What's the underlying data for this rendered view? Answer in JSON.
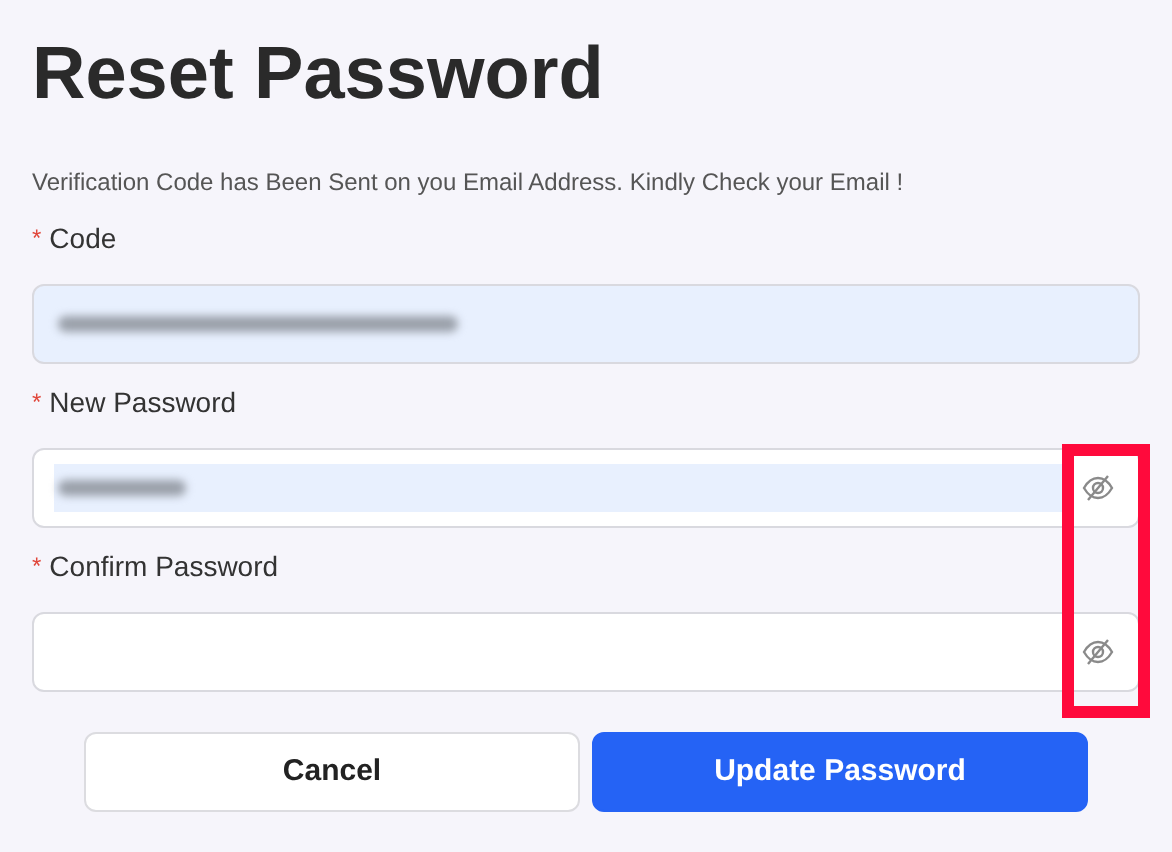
{
  "title": "Reset Password",
  "message": "Verification Code has Been Sent on you Email Address. Kindly Check your Email !",
  "fields": [
    {
      "required_mark": "*",
      "label": "Code",
      "kind": "text",
      "autofilled": true,
      "blurred": true
    },
    {
      "required_mark": "*",
      "label": "New Password",
      "kind": "password",
      "autofilled": true,
      "blurred": true
    },
    {
      "required_mark": "*",
      "label": "Confirm Password",
      "kind": "password",
      "autofilled": false,
      "blurred": false
    }
  ],
  "buttons": [
    {
      "label": "Cancel",
      "kind": "secondary"
    },
    {
      "label": "Update Password",
      "kind": "primary"
    }
  ],
  "highlight_box": true
}
